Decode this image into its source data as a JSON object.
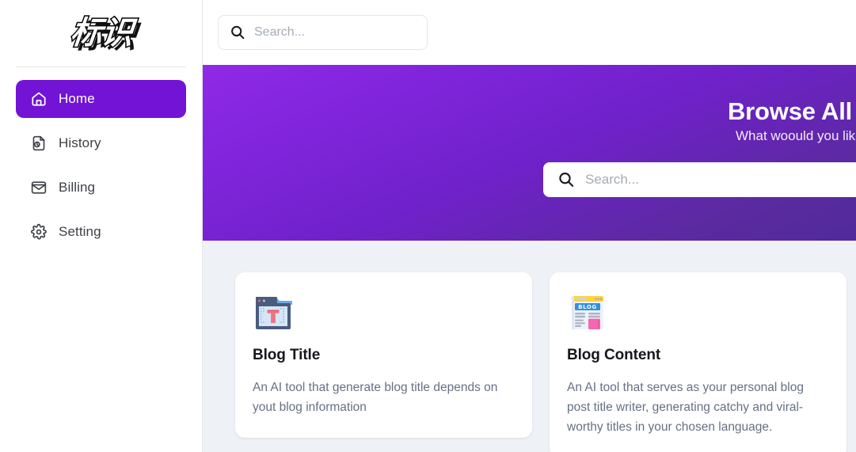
{
  "brand": {
    "logo_text": "标识"
  },
  "colors": {
    "accent_purple": "#7213d6",
    "hero_gradient_from": "#9029e6",
    "hero_gradient_to": "#512a9a",
    "content_bg": "#eef1f6",
    "card_bg": "#ffffff",
    "title_text": "#16181d",
    "muted_text": "#667085",
    "placeholder_text": "#a6abb5"
  },
  "sidebar": {
    "items": [
      {
        "label": "Home",
        "icon": "home-icon",
        "active": true
      },
      {
        "label": "History",
        "icon": "history-icon",
        "active": false
      },
      {
        "label": "Billing",
        "icon": "billing-icon",
        "active": false
      },
      {
        "label": "Setting",
        "icon": "gear-icon",
        "active": false
      }
    ]
  },
  "topbar": {
    "search": {
      "value": "",
      "placeholder": "Search...",
      "icon": "search-icon"
    }
  },
  "hero": {
    "title": "Browse All AI Tools",
    "subtitle": "What woould you like to create today?",
    "search": {
      "value": "",
      "placeholder": "Search...",
      "icon": "search-icon"
    }
  },
  "cards": [
    {
      "icon": "blog-title-icon",
      "title": "Blog Title",
      "description": "An AI tool that generate blog title depends on yout blog information"
    },
    {
      "icon": "blog-content-icon",
      "title": "Blog Content",
      "description": "An AI tool that serves as your personal blog post title writer, generating catchy and viral-worthy titles in your chosen language."
    }
  ]
}
